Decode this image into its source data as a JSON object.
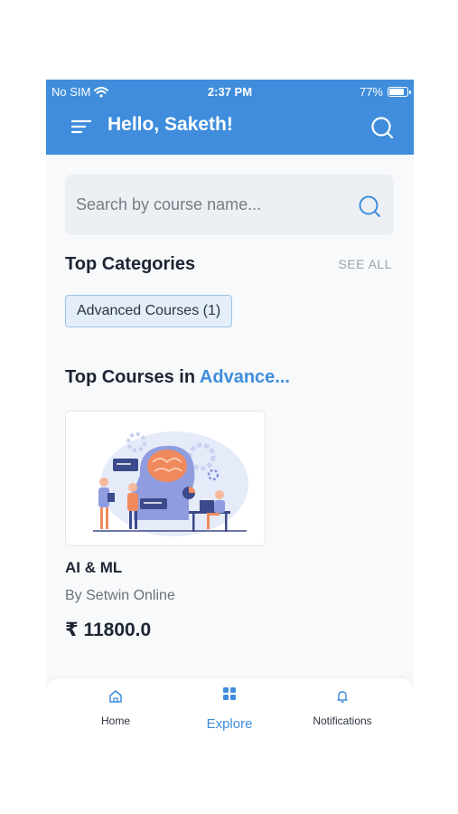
{
  "status_bar": {
    "carrier": "No SIM",
    "time": "2:37 PM",
    "battery": "77%"
  },
  "header": {
    "greeting": "Hello, Saketh!",
    "color": "#3f8ddc"
  },
  "search": {
    "placeholder": "Search by course name..."
  },
  "categories": {
    "title": "Top Categories",
    "see_all": "SEE ALL",
    "chips": [
      {
        "label": "Advanced Courses (1)"
      }
    ]
  },
  "top_courses": {
    "title_prefix": "Top Courses in ",
    "title_accent": "Advance...",
    "courses": [
      {
        "title": "AI & ML",
        "author": "By Setwin Online",
        "price": "₹ 11800.0",
        "thumbnail": "ai-illustration"
      }
    ]
  },
  "tabbar": {
    "tabs": [
      {
        "label": "Home",
        "icon": "home-icon"
      },
      {
        "label": "Explore",
        "icon": "grid-icon",
        "active": true
      },
      {
        "label": "Notifications",
        "icon": "bell-icon"
      }
    ]
  }
}
